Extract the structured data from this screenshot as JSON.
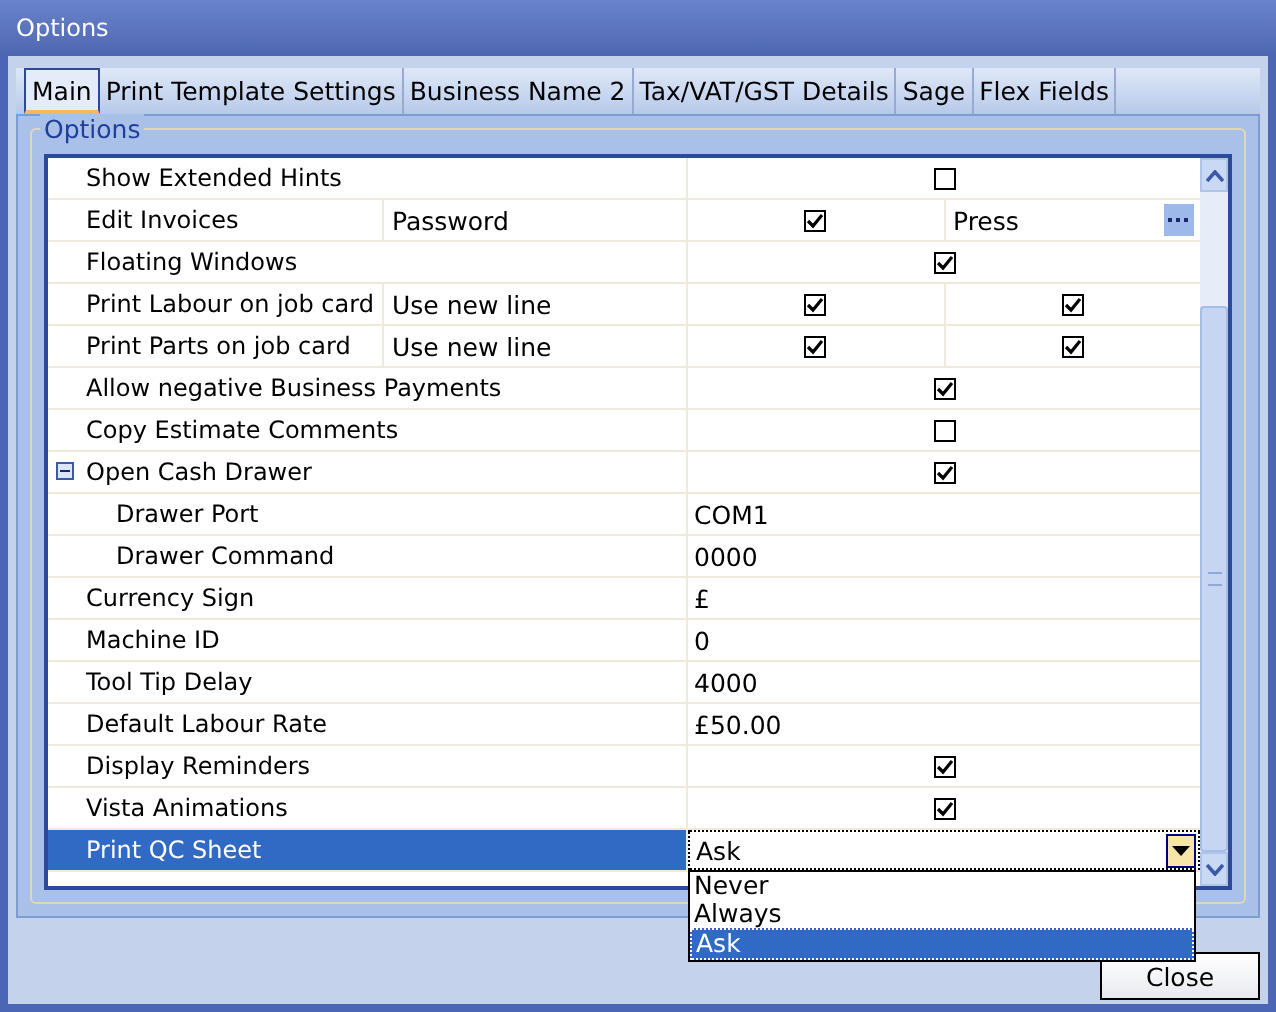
{
  "window": {
    "title": "Options"
  },
  "tabs": [
    {
      "label": "Main",
      "selected": true
    },
    {
      "label": "Print Template Settings",
      "selected": false
    },
    {
      "label": "Business Name 2",
      "selected": false
    },
    {
      "label": "Tax/VAT/GST Details",
      "selected": false
    },
    {
      "label": "Sage",
      "selected": false
    },
    {
      "label": "Flex Fields",
      "selected": false
    }
  ],
  "group": {
    "title": "Options"
  },
  "rows": [
    {
      "kind": "check",
      "name": "Show Extended Hints",
      "checked": false,
      "selected": false
    },
    {
      "kind": "split",
      "name": "Edit Invoices",
      "note": "Password",
      "selected": false,
      "cells": [
        {
          "kind": "check",
          "checked": true
        },
        {
          "kind": "button_text",
          "value": "Press"
        }
      ]
    },
    {
      "kind": "check",
      "name": "Floating Windows",
      "checked": true,
      "selected": false
    },
    {
      "kind": "split",
      "name": "Print Labour on job card",
      "note": "Use new line",
      "selected": false,
      "cells": [
        {
          "kind": "check",
          "checked": true
        },
        {
          "kind": "check",
          "checked": true
        }
      ]
    },
    {
      "kind": "split",
      "name": "Print Parts on job card",
      "note": "Use new line",
      "selected": false,
      "cells": [
        {
          "kind": "check",
          "checked": true
        },
        {
          "kind": "check",
          "checked": true
        }
      ]
    },
    {
      "kind": "check",
      "name": "Allow negative Business Payments",
      "checked": true,
      "selected": false
    },
    {
      "kind": "check",
      "name": "Copy Estimate Comments",
      "checked": false,
      "selected": false
    },
    {
      "kind": "group",
      "name": "Open Cash Drawer",
      "checked": true,
      "expanded": true,
      "selected": false,
      "children": [
        {
          "kind": "text",
          "name": "Drawer Port",
          "value": "COM1",
          "selected": false
        },
        {
          "kind": "text",
          "name": "Drawer Command",
          "value": "0000",
          "selected": false
        }
      ]
    },
    {
      "kind": "text",
      "name": "Currency Sign",
      "value": "£",
      "selected": false
    },
    {
      "kind": "text",
      "name": "Machine ID",
      "value": "0",
      "selected": false
    },
    {
      "kind": "text",
      "name": "Tool Tip Delay",
      "value": "4000",
      "selected": false
    },
    {
      "kind": "text",
      "name": "Default Labour Rate",
      "value": "£50.00",
      "selected": false
    },
    {
      "kind": "check",
      "name": "Display Reminders",
      "checked": true,
      "selected": false
    },
    {
      "kind": "check",
      "name": "Vista Animations",
      "checked": true,
      "selected": false
    },
    {
      "kind": "dropdown",
      "name": "Print QC Sheet",
      "value": "Ask",
      "selected": true,
      "options": [
        {
          "label": "Never",
          "selected": false
        },
        {
          "label": "Always",
          "selected": false
        },
        {
          "label": "Ask",
          "selected": true
        }
      ]
    }
  ],
  "buttons": [
    {
      "label": "Close"
    }
  ]
}
